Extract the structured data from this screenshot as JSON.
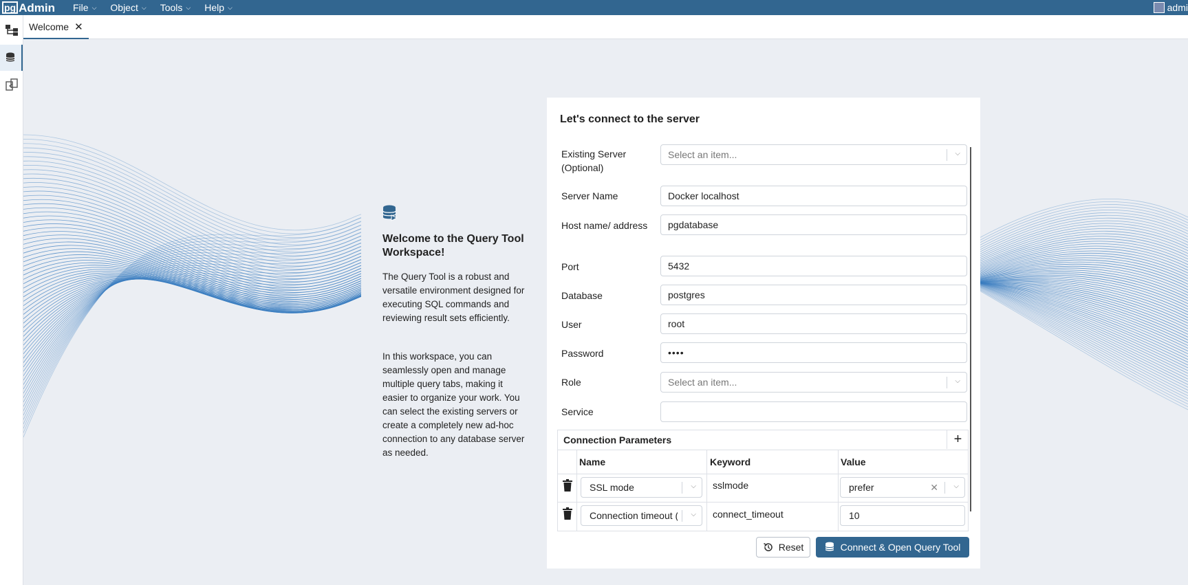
{
  "app": {
    "logo_pg": "pg",
    "logo_admin": "Admin",
    "user": "admi"
  },
  "menu": {
    "file": "File",
    "object": "Object",
    "tools": "Tools",
    "help": "Help"
  },
  "tabs": {
    "welcome": "Welcome"
  },
  "welcome": {
    "title": "Welcome to the Query Tool Workspace!",
    "p1": "The Query Tool is a robust and versatile environment designed for executing SQL commands and reviewing result sets efficiently.",
    "p2": "In this workspace, you can seamlessly open and manage multiple query tabs, making it easier to organize your work. You can select the existing servers or create a completely new ad-hoc connection to any database server as needed."
  },
  "form": {
    "title": "Let's connect to the server",
    "existing_server": {
      "label": "Existing Server (Optional)",
      "placeholder": "Select an item..."
    },
    "server_name": {
      "label": "Server Name",
      "value": "Docker localhost"
    },
    "host": {
      "label": "Host name/ address",
      "value": "pgdatabase"
    },
    "port": {
      "label": "Port",
      "value": "5432"
    },
    "database": {
      "label": "Database",
      "value": "postgres"
    },
    "user": {
      "label": "User",
      "value": "root"
    },
    "password": {
      "label": "Password",
      "value": "••••"
    },
    "role": {
      "label": "Role",
      "placeholder": "Select an item..."
    },
    "service": {
      "label": "Service",
      "value": ""
    }
  },
  "conn_params": {
    "title": "Connection Parameters",
    "headers": {
      "name": "Name",
      "keyword": "Keyword",
      "value": "Value"
    },
    "rows": [
      {
        "name": "SSL mode",
        "keyword": "sslmode",
        "value": "prefer"
      },
      {
        "name": "Connection timeout (",
        "keyword": "connect_timeout",
        "value": "10"
      }
    ]
  },
  "buttons": {
    "reset": "Reset",
    "connect": "Connect & Open Query Tool"
  },
  "colors": {
    "primary": "#326690",
    "background": "#ebeef3",
    "wave": "#3a7dc0"
  }
}
